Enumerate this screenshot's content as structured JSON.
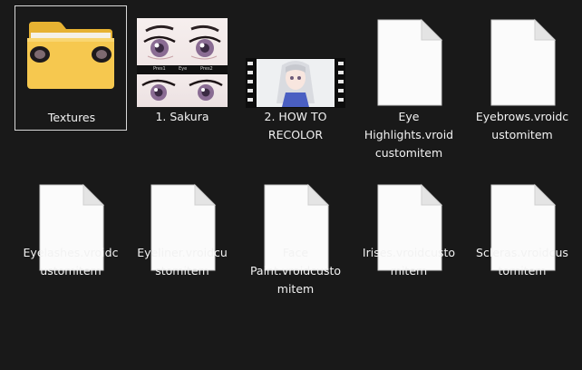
{
  "files": [
    {
      "name": "Textures",
      "type": "folder-icon"
    },
    {
      "name": "1. Sakura",
      "type": "image-thumbnail"
    },
    {
      "name": "2. HOW TO\nRECOLOR",
      "type": "video-thumbnail"
    },
    {
      "name": "Eye\nHighlights.vroid\ncustomitem",
      "type": "document-icon"
    },
    {
      "name": "Eyebrows.vroidc\nustomitem",
      "type": "document-icon"
    },
    {
      "name": "Eyelashes.vroidc\nustomitem",
      "type": "document-icon"
    },
    {
      "name": "Eyeliner.vroidcu\nstomitem",
      "type": "document-icon"
    },
    {
      "name": "Face\nPaint.vroidcusto\nmitem",
      "type": "document-icon"
    },
    {
      "name": "Irises.vroidcusto\nmitem",
      "type": "document-icon"
    },
    {
      "name": "Scleras.vroidcus\ntomitem",
      "type": "document-icon"
    }
  ],
  "sakura_captions": [
    "Pres1",
    "Eye",
    "Pres2"
  ],
  "colors": {
    "background": "#191919",
    "selection_border": "#d8d8d8",
    "folder": "#f4c64e",
    "text": "#f2f2f2"
  }
}
